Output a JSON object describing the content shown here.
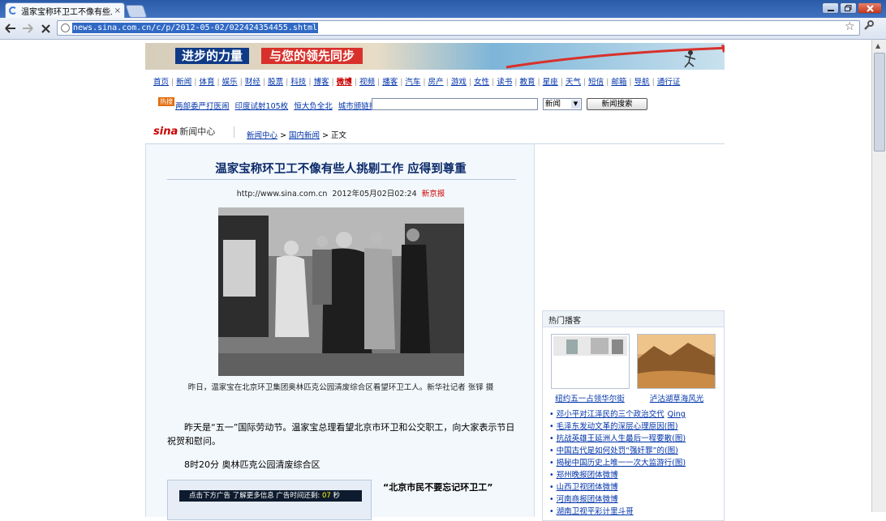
{
  "browser": {
    "tab_title": "温家宝称环卫工不像有些人",
    "tab_close": "×",
    "url": "news.sina.com.cn/c/p/2012-05-02/022424354455.shtml"
  },
  "banner": {
    "left_text": "进步的力量",
    "right_text": "与您的领先同步"
  },
  "nav": {
    "items": [
      {
        "label": "首页"
      },
      {
        "label": "新闻"
      },
      {
        "label": "体育"
      },
      {
        "label": "娱乐"
      },
      {
        "label": "财经"
      },
      {
        "label": "股票"
      },
      {
        "label": "科技"
      },
      {
        "label": "博客"
      },
      {
        "label": "微博"
      },
      {
        "label": "视频"
      },
      {
        "label": "播客"
      },
      {
        "label": "汽车"
      },
      {
        "label": "房产"
      },
      {
        "label": "游戏"
      },
      {
        "label": "女性"
      },
      {
        "label": "读书"
      },
      {
        "label": "教育"
      },
      {
        "label": "星座"
      },
      {
        "label": "天气"
      },
      {
        "label": "短信"
      },
      {
        "label": "邮箱"
      },
      {
        "label": "导航"
      },
      {
        "label": "通行证"
      }
    ]
  },
  "hot": {
    "badge": "热搜",
    "links": [
      {
        "label": "两部委严打医闹"
      },
      {
        "label": "印度试射105枚"
      },
      {
        "label": "恒大负全北"
      },
      {
        "label": "城市颁链指数"
      }
    ]
  },
  "search": {
    "input_value": "",
    "select_value": "新闻",
    "button_label": "新闻搜索"
  },
  "header": {
    "logo_text": "sina",
    "logo_sub": "新闻中心"
  },
  "breadcrumb": {
    "items": [
      {
        "label": "新闻中心"
      },
      {
        "label": "国内新闻"
      },
      {
        "label": "正文"
      }
    ],
    "sep": ">"
  },
  "article": {
    "title": "温家宝称环卫工不像有些人挑剔工作 应得到尊重",
    "site": "http://www.sina.com.cn",
    "datetime": "2012年05月02日02:24",
    "source": "新京报",
    "photo_caption": "昨日，温家宝在北京环卫集团奥林匹克公园清废综合区看望环卫工人。新华社记者 张铎 摄",
    "para1": "昨天是“五一”国际劳动节。温家宝总理看望北京市环卫和公交职工，向大家表示节日祝贺和慰问。",
    "para2": "8时20分 奥林匹克公园清废综合区",
    "ad_text": "点击下方广告 了解更多信息  广告时间还剩:",
    "ad_count": "07",
    "ad_unit": "秒",
    "quote": "“北京市民不要忘记环卫工”"
  },
  "sidebar": {
    "title": "热门播客",
    "thumbs": [
      {
        "caption": "纽约五一占领华尔街"
      },
      {
        "caption": "泸沽湖草海风光"
      }
    ],
    "list": [
      {
        "label": "邓小平对江泽民的三个政治交代",
        "user": "Qing"
      },
      {
        "label": "毛泽东发动文革的深层心理原因(图)",
        "user": ""
      },
      {
        "label": "抗战英雄王延洲人生最后一程要散(图)",
        "user": ""
      },
      {
        "label": "中国古代是如何处罚“强奸罪”的(图)",
        "user": ""
      },
      {
        "label": "揭秘中国历史上唯一一次大监游行(图)",
        "user": ""
      },
      {
        "label": "郑州晚报团体微博",
        "user": ""
      },
      {
        "label": "山西卫视团体微博",
        "user": ""
      },
      {
        "label": "河南商报团体微博",
        "user": ""
      },
      {
        "label": "湖南卫视平彩计里斗哥",
        "user": ""
      }
    ]
  },
  "colors": {
    "link": "#0033aa",
    "title": "#0c2a6a",
    "accent_red": "#cc0000",
    "banner_blue": "#0f3a86",
    "banner_red": "#d8312b"
  }
}
